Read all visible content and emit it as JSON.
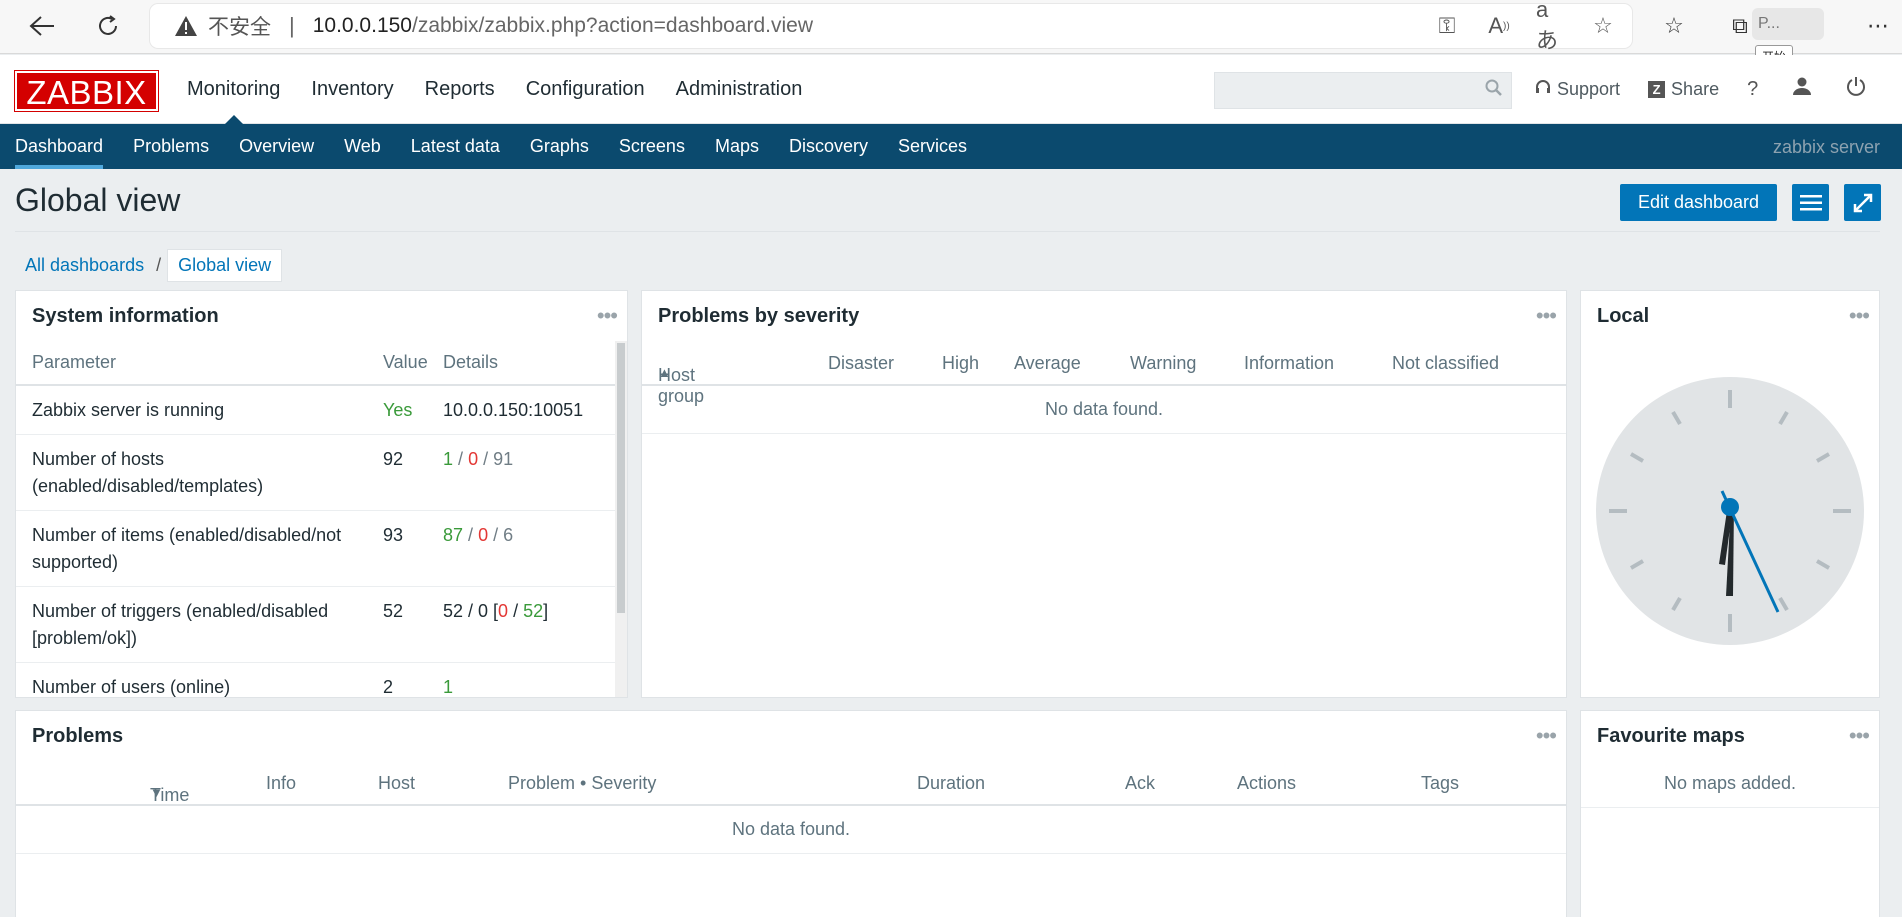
{
  "browser": {
    "security_warning": "不安全",
    "separator": "|",
    "url_host": "10.0.0.150",
    "url_path": "/zabbix/zabbix.php?action=dashboard.view",
    "tooltip": "开始",
    "profile_initial": "P..."
  },
  "header": {
    "logo": "ZABBIX",
    "menu": [
      "Monitoring",
      "Inventory",
      "Reports",
      "Configuration",
      "Administration"
    ],
    "search_placeholder": "",
    "support": "Support",
    "share": "Share",
    "help": "?"
  },
  "subnav": {
    "items": [
      "Dashboard",
      "Problems",
      "Overview",
      "Web",
      "Latest data",
      "Graphs",
      "Screens",
      "Maps",
      "Discovery",
      "Services"
    ],
    "server_name": "zabbix server"
  },
  "page": {
    "title": "Global view",
    "edit_button": "Edit dashboard",
    "breadcrumb_root": "All dashboards",
    "breadcrumb_sep": "/",
    "breadcrumb_current": "Global view"
  },
  "system_info": {
    "title": "System information",
    "headers": [
      "Parameter",
      "Value",
      "Details"
    ],
    "rows": [
      {
        "param": "Zabbix server is running",
        "value": "Yes",
        "details": "10.0.0.150:10051"
      },
      {
        "param": "Number of hosts (enabled/disabled/templates)",
        "value": "92",
        "d1": "1",
        "d2": "0",
        "d3": "91"
      },
      {
        "param": "Number of items (enabled/disabled/not supported)",
        "value": "93",
        "d1": "87",
        "d2": "0",
        "d3": "6"
      },
      {
        "param": "Number of triggers (enabled/disabled [problem/ok])",
        "value": "52",
        "d_prefix": "52 / 0 [",
        "d1": "0",
        "d2": "52",
        "d_suffix": "]"
      },
      {
        "param": "Number of users (online)",
        "value": "2",
        "details": "1"
      }
    ]
  },
  "problems_by_severity": {
    "title": "Problems by severity",
    "headers": [
      "Host group",
      "Disaster",
      "High",
      "Average",
      "Warning",
      "Information",
      "Not classified"
    ],
    "empty": "No data found."
  },
  "clock": {
    "title": "Local"
  },
  "problems": {
    "title": "Problems",
    "headers": [
      "Time",
      "Info",
      "Host",
      "Problem • Severity",
      "Duration",
      "Ack",
      "Actions",
      "Tags"
    ],
    "empty": "No data found."
  },
  "favourite_maps": {
    "title": "Favourite maps",
    "empty": "No maps added."
  },
  "colors": {
    "accent": "#0275b8",
    "nav": "#0b4a6e",
    "logo": "#d40000",
    "ok_green": "#3a9a3a",
    "problem_red": "#e33734"
  }
}
